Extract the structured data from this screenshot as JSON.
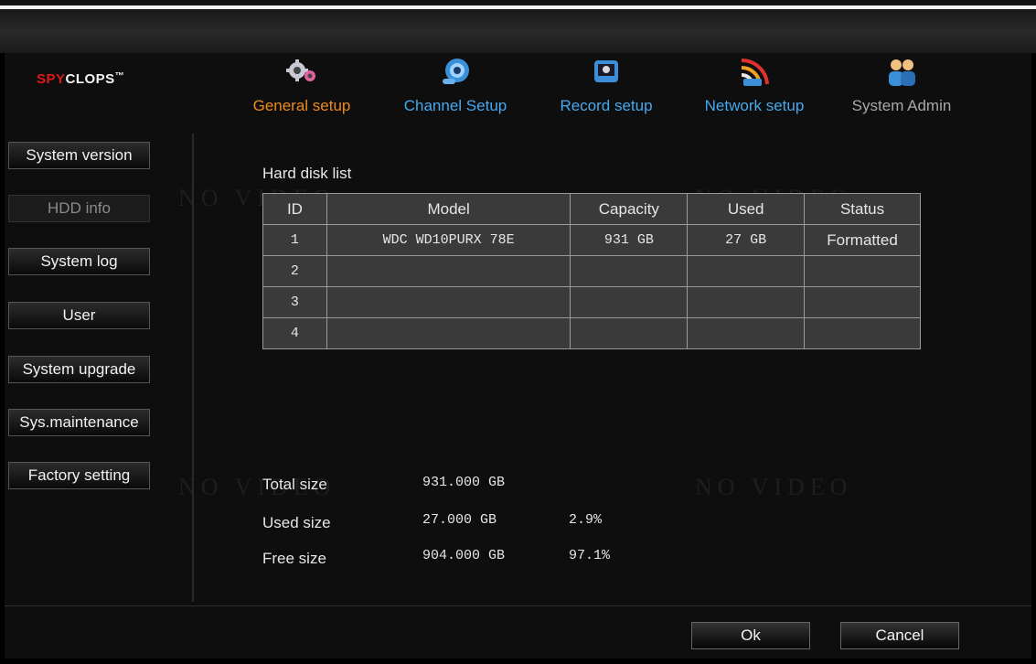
{
  "brand": {
    "logo_red": "SPY",
    "logo_white": "CLOPS",
    "logo_tm": "™"
  },
  "tabs": [
    {
      "label": "General setup",
      "icon": "gears-icon",
      "color": "#f08a1a"
    },
    {
      "label": "Channel Setup",
      "icon": "camera-icon",
      "color": "#46a8ee"
    },
    {
      "label": "Record setup",
      "icon": "record-icon",
      "color": "#46a8ee"
    },
    {
      "label": "Network setup",
      "icon": "network-icon",
      "color": "#46a8ee"
    },
    {
      "label": "System Admin",
      "icon": "users-icon",
      "color": "#a8a8a8"
    }
  ],
  "sidebar": {
    "items": [
      {
        "label": "System version"
      },
      {
        "label": "HDD info",
        "active": true
      },
      {
        "label": "System log"
      },
      {
        "label": "User"
      },
      {
        "label": "System upgrade"
      },
      {
        "label": "Sys.maintenance"
      },
      {
        "label": "Factory setting"
      }
    ]
  },
  "watermark": {
    "text": "NO VIDEO"
  },
  "hdd": {
    "title": "Hard disk list",
    "columns": [
      "ID",
      "Model",
      "Capacity",
      "Used",
      "Status"
    ],
    "rows": [
      {
        "id": "1",
        "model": "WDC WD10PURX 78E",
        "capacity": "931 GB",
        "used": "27 GB",
        "status": "Formatted"
      },
      {
        "id": "2",
        "model": "",
        "capacity": "",
        "used": "",
        "status": ""
      },
      {
        "id": "3",
        "model": "",
        "capacity": "",
        "used": "",
        "status": ""
      },
      {
        "id": "4",
        "model": "",
        "capacity": "",
        "used": "",
        "status": ""
      }
    ]
  },
  "summary": {
    "total_label": "Total size",
    "total_value": "931.000 GB",
    "used_label": "Used size",
    "used_value": "27.000 GB",
    "used_pct": "2.9%",
    "free_label": "Free size",
    "free_value": "904.000 GB",
    "free_pct": "97.1%"
  },
  "actions": {
    "ok": "Ok",
    "cancel": "Cancel"
  }
}
